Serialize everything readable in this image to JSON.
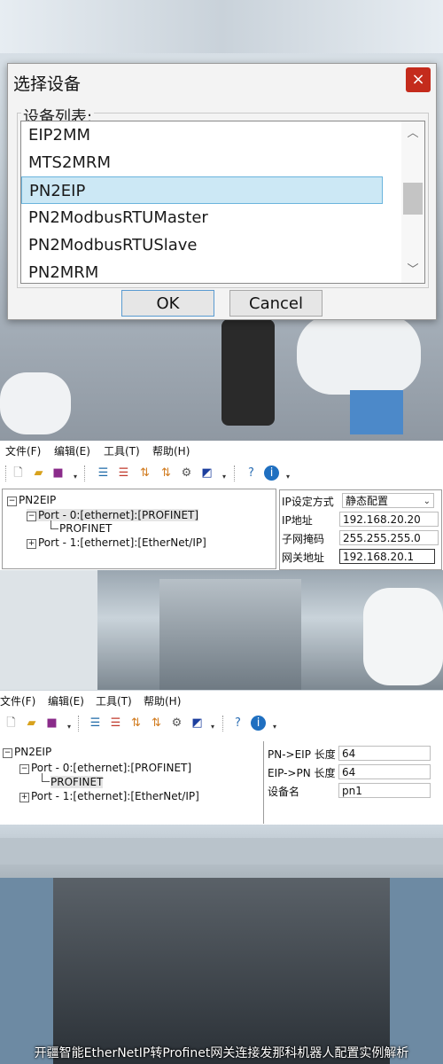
{
  "dialog": {
    "title": "选择设备",
    "group_label": "设备列表:",
    "items": [
      "EIP2MM",
      "MTS2MRM",
      "PN2EIP",
      "PN2ModbusRTUMaster",
      "PN2ModbusRTUSlave",
      "PN2MRM"
    ],
    "selected": "PN2EIP",
    "ok_label": "OK",
    "cancel_label": "Cancel",
    "close_glyph": "×"
  },
  "menus": [
    "文件(F)",
    "编辑(E)",
    "工具(T)",
    "帮助(H)"
  ],
  "toolbar": {
    "icons": [
      "new-file-icon",
      "open-folder-icon",
      "save-icon",
      "add-device-icon",
      "delete-device-icon",
      "upload-icon",
      "download-icon",
      "settings-gear-icon",
      "config-icon",
      "help-icon",
      "info-icon"
    ]
  },
  "tree": {
    "root": "PN2EIP",
    "port0": "Port - 0:[ethernet]:[PROFINET]",
    "port0_child": "PROFINET",
    "port1": "Port - 1:[ethernet]:[EtherNet/IP]",
    "expand_minus": "−",
    "expand_plus": "+"
  },
  "props1": [
    {
      "label": "IP设定方式",
      "value": "静态配置"
    },
    {
      "label": "IP地址",
      "value": "192.168.20.20"
    },
    {
      "label": "子网掩码",
      "value": "255.255.255.0"
    },
    {
      "label": "网关地址",
      "value": "192.168.20.1"
    }
  ],
  "props2": [
    {
      "label": "PN->EIP 长度",
      "value": "64"
    },
    {
      "label": "EIP->PN 长度",
      "value": "64"
    },
    {
      "label": "设备名",
      "value": "pn1"
    }
  ],
  "caption": "开疆智能EtherNetIP转Profinet网关连接发那科机器人配置实例解析"
}
